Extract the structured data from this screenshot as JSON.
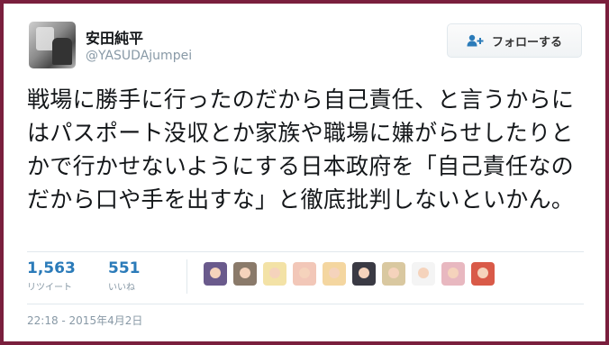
{
  "user": {
    "display_name": "安田純平",
    "handle": "@YASUDAjumpei"
  },
  "follow_button": {
    "label": "フォローする",
    "icon": "add-person-icon"
  },
  "tweet": {
    "text": "戦場に勝手に行ったのだから自己責任、と言うからにはパスポート没収とか家族や職場に嫌がらせしたりとかで行かせないようにする日本政府を「自己責任なのだから口や手を出すな」と徹底批判しないといかん。"
  },
  "stats": {
    "retweets": {
      "count": "1,563",
      "label": "リツイート"
    },
    "likes": {
      "count": "551",
      "label": "いいね"
    }
  },
  "likers": [
    {
      "avatar": "flowers",
      "color": "#6a5a8c"
    },
    {
      "avatar": "figure",
      "color": "#8a7a6a"
    },
    {
      "avatar": "anime-blonde",
      "color": "#f3e2a6"
    },
    {
      "avatar": "anime-face",
      "color": "#f2c7b8"
    },
    {
      "avatar": "cartoon-face",
      "color": "#f4d6a0"
    },
    {
      "avatar": "anime-dark",
      "color": "#3a3a44"
    },
    {
      "avatar": "anime-glasses",
      "color": "#d9c8a0"
    },
    {
      "avatar": "sketch",
      "color": "#f4f4f4"
    },
    {
      "avatar": "anime-girl",
      "color": "#e8b8c0"
    },
    {
      "avatar": "anime-red",
      "color": "#d95a48"
    }
  ],
  "timestamp": "22:18 - 2015年4月2日",
  "colors": {
    "background": "#7a1f3d",
    "link_blue": "#2b7bb9",
    "muted": "#8899a6"
  }
}
